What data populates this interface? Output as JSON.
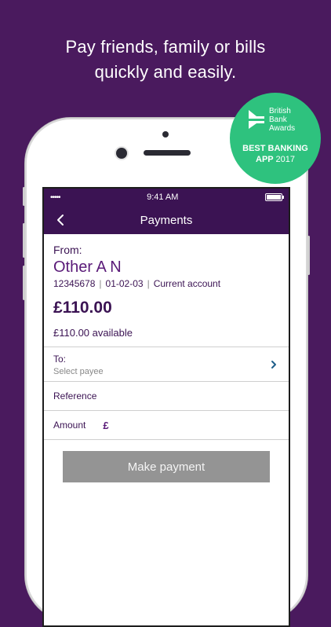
{
  "headline": {
    "line1": "Pay friends, family or bills",
    "line2": "quickly and easily."
  },
  "badge": {
    "brand_line1": "British",
    "brand_line2": "Bank",
    "brand_line3": "Awards",
    "award_line1": "BEST BANKING",
    "award_line2a": "APP",
    "award_year": "2017",
    "color": "#2ec27e"
  },
  "status": {
    "signal": "•••••",
    "time": "9:41 AM"
  },
  "nav": {
    "title": "Payments",
    "back_icon": "chevron-left-icon"
  },
  "from": {
    "label": "From:",
    "name": "Other A N",
    "account_number": "12345678",
    "sort_code": "01-02-03",
    "account_type": "Current account",
    "balance": "£110.00",
    "available": "£110.00 available"
  },
  "form": {
    "to_label": "To:",
    "to_placeholder": "Select payee",
    "reference_label": "Reference",
    "amount_label": "Amount",
    "currency_symbol": "£",
    "submit_label": "Make payment"
  },
  "colors": {
    "background": "#4a1a5e",
    "brand": "#3b1353",
    "button_disabled": "#949494"
  }
}
